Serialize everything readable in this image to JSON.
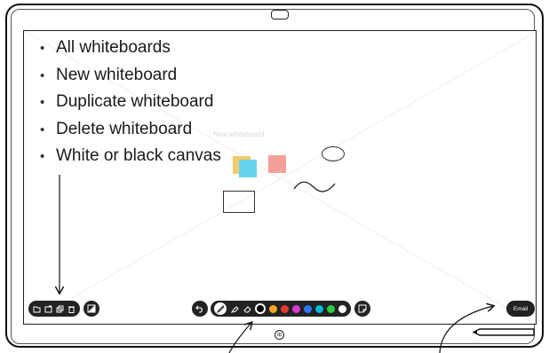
{
  "bullets": [
    "All whiteboards",
    "New whiteboard",
    "Duplicate whiteboard",
    "Delete whiteboard",
    "White or black canvas"
  ],
  "canvas": {
    "ghost_title": "New whiteboard"
  },
  "left_toolbar": {
    "icons": [
      "folder-icon",
      "new-board-icon",
      "duplicate-icon",
      "delete-icon"
    ],
    "canvas_toggle_icon": "canvas-toggle-icon"
  },
  "center_toolbar": {
    "undo_icon": "undo-icon",
    "tools": [
      "pen-icon",
      "highlighter-icon",
      "eraser-icon"
    ],
    "colors": [
      "#000000",
      "#f5a623",
      "#e53935",
      "#d63ad8",
      "#2979ff",
      "#00b8d4",
      "#2ecc40",
      "#ffffff"
    ],
    "selected_color": "#000000",
    "sticky_note_icon": "sticky-note-icon"
  },
  "email_button": {
    "label": "Email"
  },
  "sticky_colors": [
    "#f6c96b",
    "#66d4ef",
    "#f4a09a"
  ],
  "home_icon": "home-icon"
}
